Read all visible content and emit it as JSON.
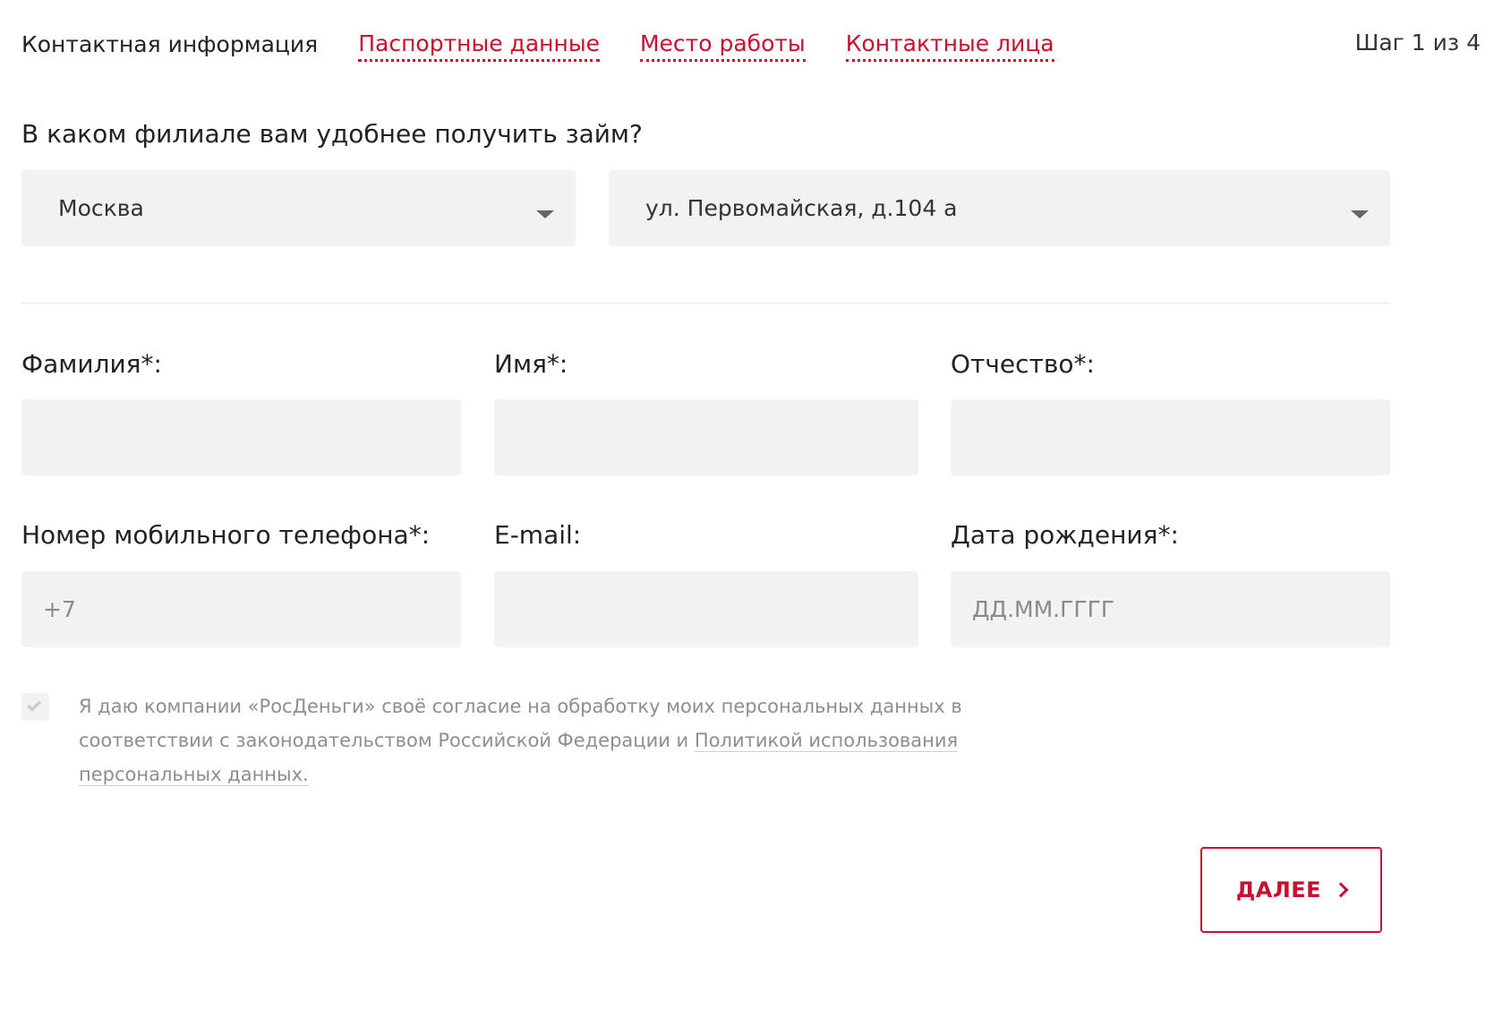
{
  "steps": {
    "items": [
      {
        "label": "Контактная информация",
        "active": true
      },
      {
        "label": "Паспортные данные",
        "active": false
      },
      {
        "label": "Место работы",
        "active": false
      },
      {
        "label": "Контактные лица",
        "active": false
      }
    ],
    "counter": "Шаг 1 из 4"
  },
  "branch": {
    "question": "В каком филиале вам удобнее получить займ?",
    "city": "Москва",
    "address": "ул. Первомайская, д.104 а"
  },
  "form": {
    "lastname_label": "Фамилия*:",
    "firstname_label": "Имя*:",
    "patronymic_label": "Отчество*:",
    "phone_label": "Номер мобильного телефона*:",
    "phone_value": "+7",
    "email_label": "E-mail:",
    "birthdate_label": "Дата рождения*:",
    "birthdate_placeholder": "ДД.ММ.ГГГГ"
  },
  "consent": {
    "checked": true,
    "text": "Я даю компании «РосДеньги» своё согласие на обработку моих персональных данных в соответствии с законодательством Российской Федерации и ",
    "link": "Политикой использования персональных данных."
  },
  "next_button": {
    "label": "ДАЛЕЕ"
  },
  "colors": {
    "accent": "#c8102e",
    "field_bg": "#f2f2f2",
    "muted_text": "#8e8e8e"
  },
  "icons": {
    "select_caret": "caret-down-icon",
    "next": "chevron-right-icon",
    "checkbox": "check-icon"
  }
}
